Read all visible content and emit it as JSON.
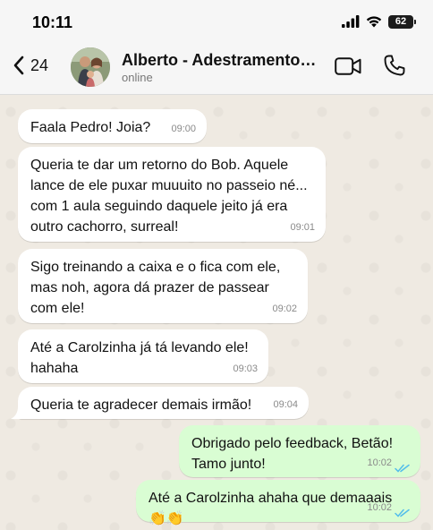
{
  "status_bar": {
    "time": "10:11",
    "battery": "62"
  },
  "header": {
    "back_count": "24",
    "contact_name": "Alberto - Adestramento B...",
    "contact_status": "online"
  },
  "messages": [
    {
      "direction": "in",
      "text": "Faala Pedro! Joia?",
      "time": "09:00"
    },
    {
      "direction": "in",
      "text": "Queria te dar um retorno do Bob. Aquele lance de ele puxar muuuito no passeio né... com 1 aula seguindo daquele jeito já era outro cachorro, surreal!",
      "time": "09:01"
    },
    {
      "direction": "in",
      "text": "Sigo treinando a caixa e o fica com ele, mas noh, agora dá prazer de passear com ele!",
      "time": "09:02"
    },
    {
      "direction": "in",
      "text": "Até a Carolzinha já tá levando ele! hahaha",
      "time": "09:03"
    },
    {
      "direction": "in",
      "text": "Queria te agradecer demais irmão!",
      "time": "09:04"
    },
    {
      "direction": "out",
      "text": "Obrigado pelo feedback, Betão! Tamo junto!",
      "time": "10:02",
      "status": "read"
    },
    {
      "direction": "out",
      "text": "Até a Carolzinha ahaha que demaaais 👏👏",
      "time": "10:02",
      "status": "read"
    }
  ],
  "colors": {
    "incoming_bubble": "#ffffff",
    "outgoing_bubble": "#d9fdd3",
    "read_ticks": "#53bdeb",
    "chat_background": "#efeae2"
  },
  "icons": [
    "signal-icon",
    "wifi-icon",
    "battery-icon",
    "back-chevron-icon",
    "video-call-icon",
    "phone-icon",
    "double-check-icon"
  ]
}
